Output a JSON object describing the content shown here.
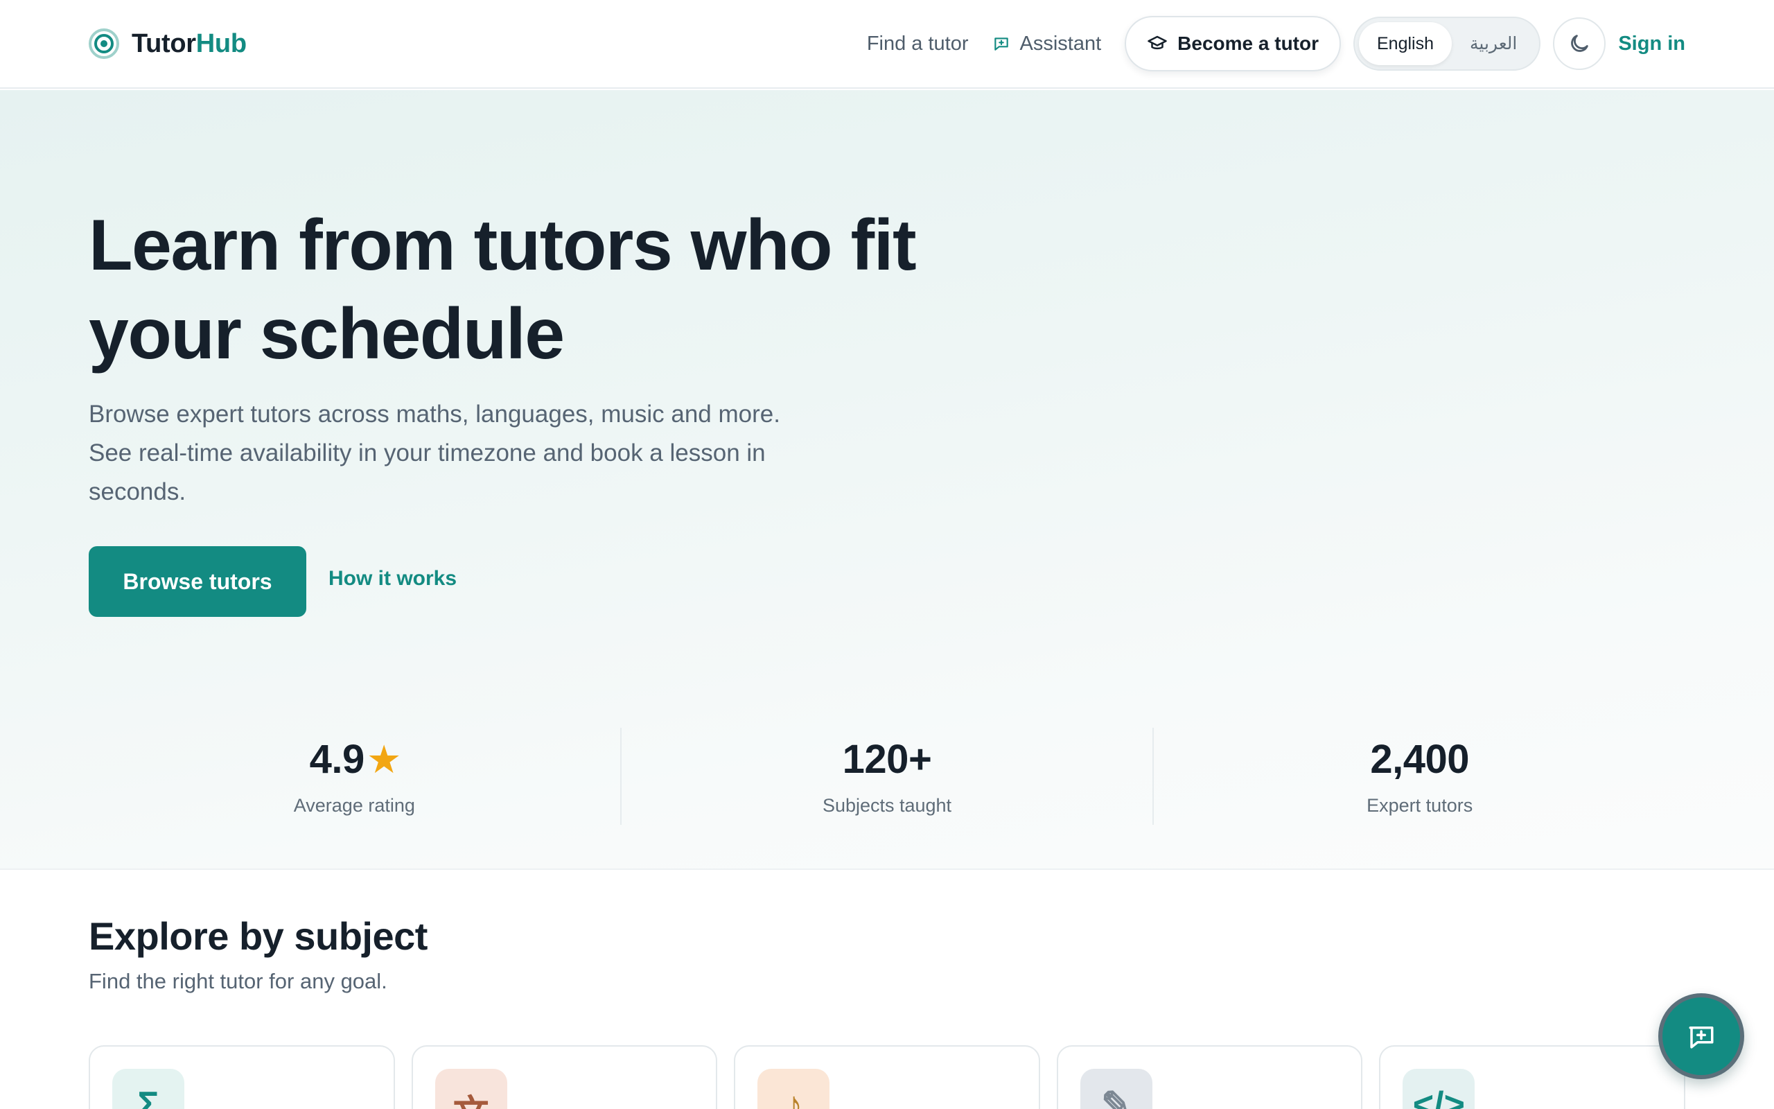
{
  "brand": {
    "name_part1": "Tutor",
    "name_part2": "Hub"
  },
  "nav": {
    "find_tutor": "Find a tutor",
    "assistant": "Assistant",
    "become_tutor": "Become a tutor",
    "lang_english": "English",
    "lang_arabic": "العربية",
    "sign_in": "Sign in"
  },
  "hero": {
    "title": "Learn from tutors who fit your schedule",
    "subtitle": "Browse expert tutors across maths, languages, music and more. See real-time availability in your timezone and book a lesson in seconds.",
    "browse_label": "Browse tutors",
    "how_label": "How it works"
  },
  "stats": [
    {
      "value": "4.9",
      "icon": "star",
      "label": "Average rating"
    },
    {
      "value": "120+",
      "label": "Subjects taught"
    },
    {
      "value": "2,400",
      "label": "Expert tutors"
    }
  ],
  "explore": {
    "title": "Explore by subject",
    "subtitle": "Find the right tutor for any goal."
  },
  "subjects": [
    {
      "icon": "sigma-icon",
      "glyph": "Σ",
      "bg": "#e4f3f1",
      "color": "#138b82"
    },
    {
      "icon": "language-icon",
      "glyph": "文",
      "bg": "#f8e4dc",
      "color": "#a55a3c"
    },
    {
      "icon": "music-note-icon",
      "glyph": "♪",
      "bg": "#fbe6d6",
      "color": "#b9822a"
    },
    {
      "icon": "pencil-icon",
      "glyph": "✎",
      "bg": "#e3e7ec",
      "color": "#7c8793"
    },
    {
      "icon": "code-icon",
      "glyph": "</>",
      "bg": "#e4f1f1",
      "color": "#138b82"
    }
  ],
  "colors": {
    "accent": "#138b82",
    "star": "#f2a613",
    "text": "#16202b"
  }
}
